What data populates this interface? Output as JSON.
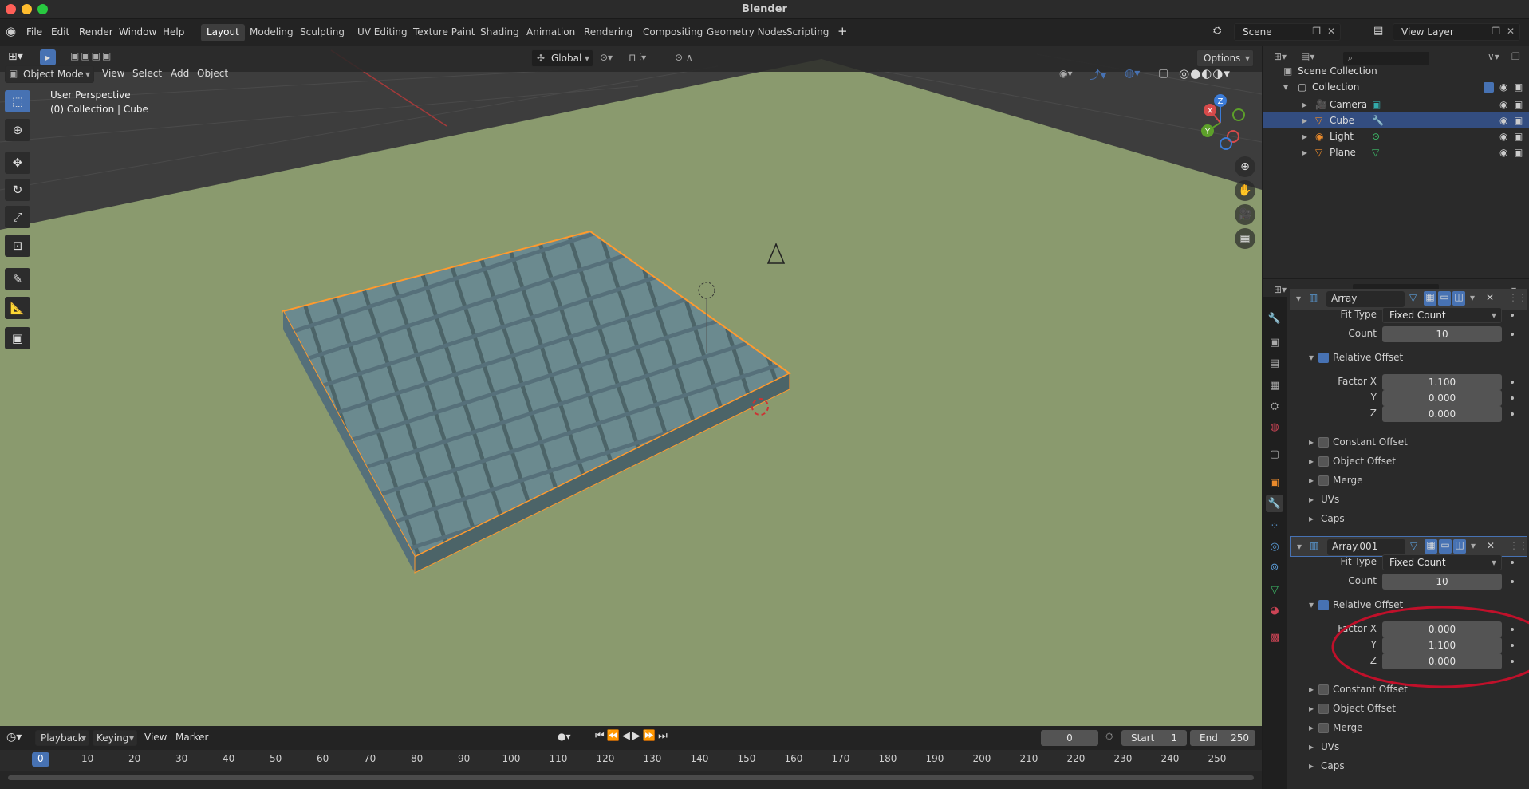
{
  "window": {
    "title": "Blender"
  },
  "menus": {
    "file": "File",
    "edit": "Edit",
    "render": "Render",
    "window": "Window",
    "help": "Help"
  },
  "workspaces": [
    {
      "label": "Layout",
      "active": true
    },
    {
      "label": "Modeling"
    },
    {
      "label": "Sculpting"
    },
    {
      "label": "UV Editing"
    },
    {
      "label": "Texture Paint"
    },
    {
      "label": "Shading"
    },
    {
      "label": "Animation"
    },
    {
      "label": "Rendering"
    },
    {
      "label": "Compositing"
    },
    {
      "label": "Geometry Nodes"
    },
    {
      "label": "Scripting"
    }
  ],
  "scene": {
    "name": "Scene",
    "view_layer": "View Layer"
  },
  "viewport": {
    "mode": "Object Mode",
    "menus": {
      "view": "View",
      "select": "Select",
      "add": "Add",
      "object": "Object"
    },
    "orientation": "Global",
    "options": "Options",
    "overlay_line1": "User Perspective",
    "overlay_line2": "(0) Collection | Cube",
    "gizmo": {
      "x": "X",
      "y": "Y",
      "z": "Z"
    }
  },
  "outliner": {
    "root": "Scene Collection",
    "collection": "Collection",
    "items": [
      {
        "name": "Camera"
      },
      {
        "name": "Cube",
        "selected": true
      },
      {
        "name": "Light"
      },
      {
        "name": "Plane"
      }
    ]
  },
  "properties": {
    "modifiers": [
      {
        "name": "Array",
        "fit_type_label": "Fit Type",
        "fit_type": "Fixed Count",
        "count_label": "Count",
        "count": "10",
        "relative_offset": "Relative Offset",
        "factor_x_label": "Factor X",
        "factor_x": "1.100",
        "y_label": "Y",
        "factor_y": "0.000",
        "z_label": "Z",
        "factor_z": "0.000",
        "constant_offset": "Constant Offset",
        "object_offset": "Object Offset",
        "merge": "Merge",
        "uvs": "UVs",
        "caps": "Caps"
      },
      {
        "name": "Array.001",
        "fit_type_label": "Fit Type",
        "fit_type": "Fixed Count",
        "count_label": "Count",
        "count": "10",
        "relative_offset": "Relative Offset",
        "factor_x_label": "Factor X",
        "factor_x": "0.000",
        "y_label": "Y",
        "factor_y": "1.100",
        "z_label": "Z",
        "factor_z": "0.000",
        "constant_offset": "Constant Offset",
        "object_offset": "Object Offset",
        "merge": "Merge",
        "uvs": "UVs",
        "caps": "Caps"
      }
    ]
  },
  "timeline": {
    "playback": "Playback",
    "keying": "Keying",
    "view": "View",
    "marker": "Marker",
    "current_frame": "0",
    "start_label": "Start",
    "start": "1",
    "end_label": "End",
    "end": "250",
    "ruler_marks": [
      "0",
      "10",
      "20",
      "30",
      "40",
      "50",
      "60",
      "70",
      "80",
      "90",
      "100",
      "110",
      "120",
      "130",
      "140",
      "150",
      "160",
      "170",
      "180",
      "190",
      "200",
      "210",
      "220",
      "230",
      "240",
      "250"
    ]
  },
  "colors": {
    "accent": "#4772b3",
    "selection_outline": "#ff9a2e",
    "ground": "#8a9a6e",
    "cube": "#6b8a8f",
    "annotation": "#c0102a"
  }
}
